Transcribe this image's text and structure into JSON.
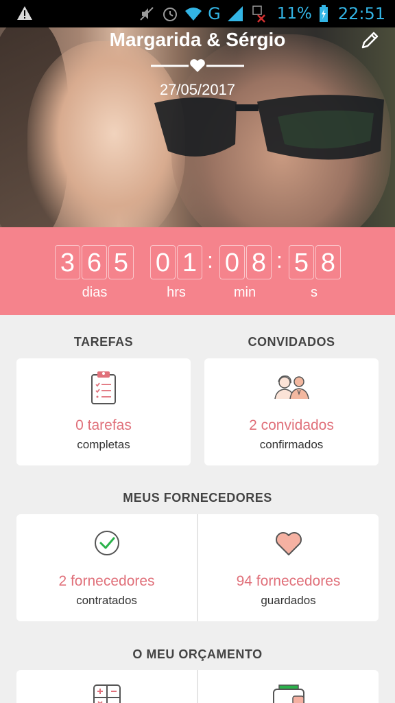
{
  "status_bar": {
    "network": "G",
    "battery": "11%",
    "time": "22:51"
  },
  "hero": {
    "title": "Margarida & Sérgio",
    "date": "27/05/2017"
  },
  "countdown": {
    "days": [
      "3",
      "6",
      "5"
    ],
    "hours": [
      "0",
      "1"
    ],
    "minutes": [
      "0",
      "8"
    ],
    "seconds": [
      "5",
      "8"
    ],
    "labels": {
      "days": "dias",
      "hours": "hrs",
      "minutes": "min",
      "seconds": "s"
    }
  },
  "tasks": {
    "heading": "TAREFAS",
    "count": "0 tarefas",
    "sub": "completas"
  },
  "guests": {
    "heading": "CONVIDADOS",
    "count": "2 convidados",
    "sub": "confirmados"
  },
  "vendors": {
    "heading": "MEUS FORNECEDORES",
    "hired_count": "2 fornecedores",
    "hired_sub": "contratados",
    "saved_count": "94 fornecedores",
    "saved_sub": "guardados"
  },
  "budget": {
    "heading": "O MEU ORÇAMENTO"
  },
  "colors": {
    "accent": "#f5838c",
    "accent_text": "#e0707a",
    "status_blue": "#33b5e5",
    "check_green": "#2ab24a"
  }
}
